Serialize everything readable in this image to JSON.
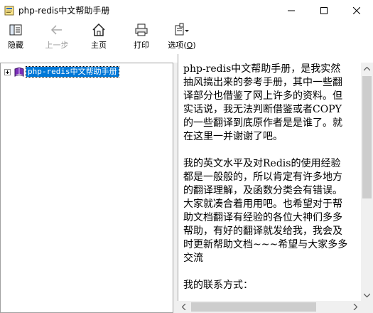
{
  "window": {
    "title": "php-redis中文帮助手册"
  },
  "toolbar": {
    "hide_label": "隐藏",
    "back_label": "上一步",
    "home_label": "主页",
    "print_label": "打印",
    "options_label": "选项(",
    "options_key": "O",
    "options_close": ")"
  },
  "tree": {
    "items": [
      {
        "label": "php-redis中文帮助手册",
        "selected": true,
        "expanded": false
      }
    ]
  },
  "content": {
    "paragraphs": [
      "php-redis中文帮助手册，是我实然抽风搞出来的参考手册，其中一些翻译部分也借鉴了网上许多的资料。但实话说，我无法判断借鉴或者COPY的一些翻译到底原作者是是谁了。就在这里一并谢谢了吧。",
      "我的英文水平及对Redis的使用经验都是一般般的，所以肯定有许多地方的翻译理解，及函数分类会有错误。大家就凑合着用用吧。也希望对于帮助文档翻译有经验的各位大神们多多帮助，有好的翻译就发给我，我会及时更新帮助文档~~~希望与大家多多交流",
      "我的联系方式："
    ]
  },
  "colors": {
    "selection": "#0078d7",
    "disabled_text": "#9a9a9a",
    "scrollbar_track": "#f0f0f0",
    "scrollbar_thumb": "#cdcdcd"
  }
}
